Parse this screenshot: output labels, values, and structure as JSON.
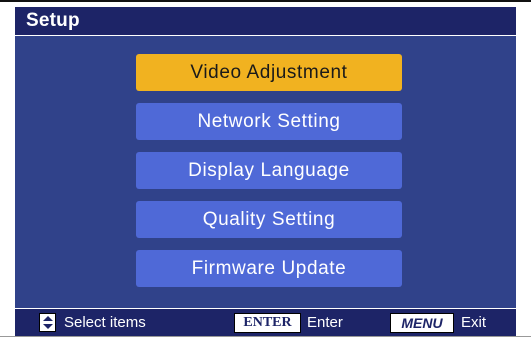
{
  "header": {
    "title": "Setup"
  },
  "menu": {
    "items": [
      {
        "label": "Video Adjustment",
        "selected": true
      },
      {
        "label": "Network Setting",
        "selected": false
      },
      {
        "label": "Display Language",
        "selected": false
      },
      {
        "label": "Quality Setting",
        "selected": false
      },
      {
        "label": "Firmware Update",
        "selected": false
      }
    ]
  },
  "footer": {
    "select_label": "Select items",
    "enter_key": "ENTER",
    "enter_label": "Enter",
    "menu_key": "MENU",
    "exit_label": "Exit",
    "select_icon": "up-down-arrows-icon"
  },
  "colors": {
    "screen_bg": "#30428a",
    "bar_bg": "#1d2467",
    "button_bg": "#4f69d7",
    "selected_bg": "#f1b220"
  }
}
